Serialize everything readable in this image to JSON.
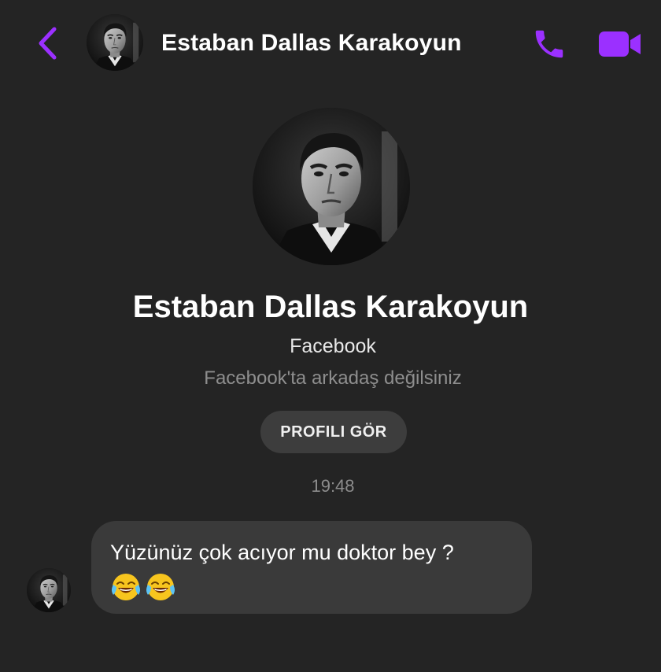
{
  "header": {
    "back_icon": "chevron-left-icon",
    "name": "Estaban Dallas Karakoyun",
    "call_icon": "phone-icon",
    "video_icon": "video-camera-icon",
    "accent_color": "#9b30ff"
  },
  "profile": {
    "name": "Estaban Dallas Karakoyun",
    "source": "Facebook",
    "note": "Facebook'ta arkadaş değilsiniz",
    "button_label": "PROFILI GÖR"
  },
  "conversation": {
    "timestamp": "19:48",
    "messages": [
      {
        "text": "Yüzünüz çok acıyor mu doktor bey ?",
        "emojis": [
          "face-with-tears-of-joy-icon",
          "face-with-tears-of-joy-icon"
        ]
      }
    ]
  }
}
